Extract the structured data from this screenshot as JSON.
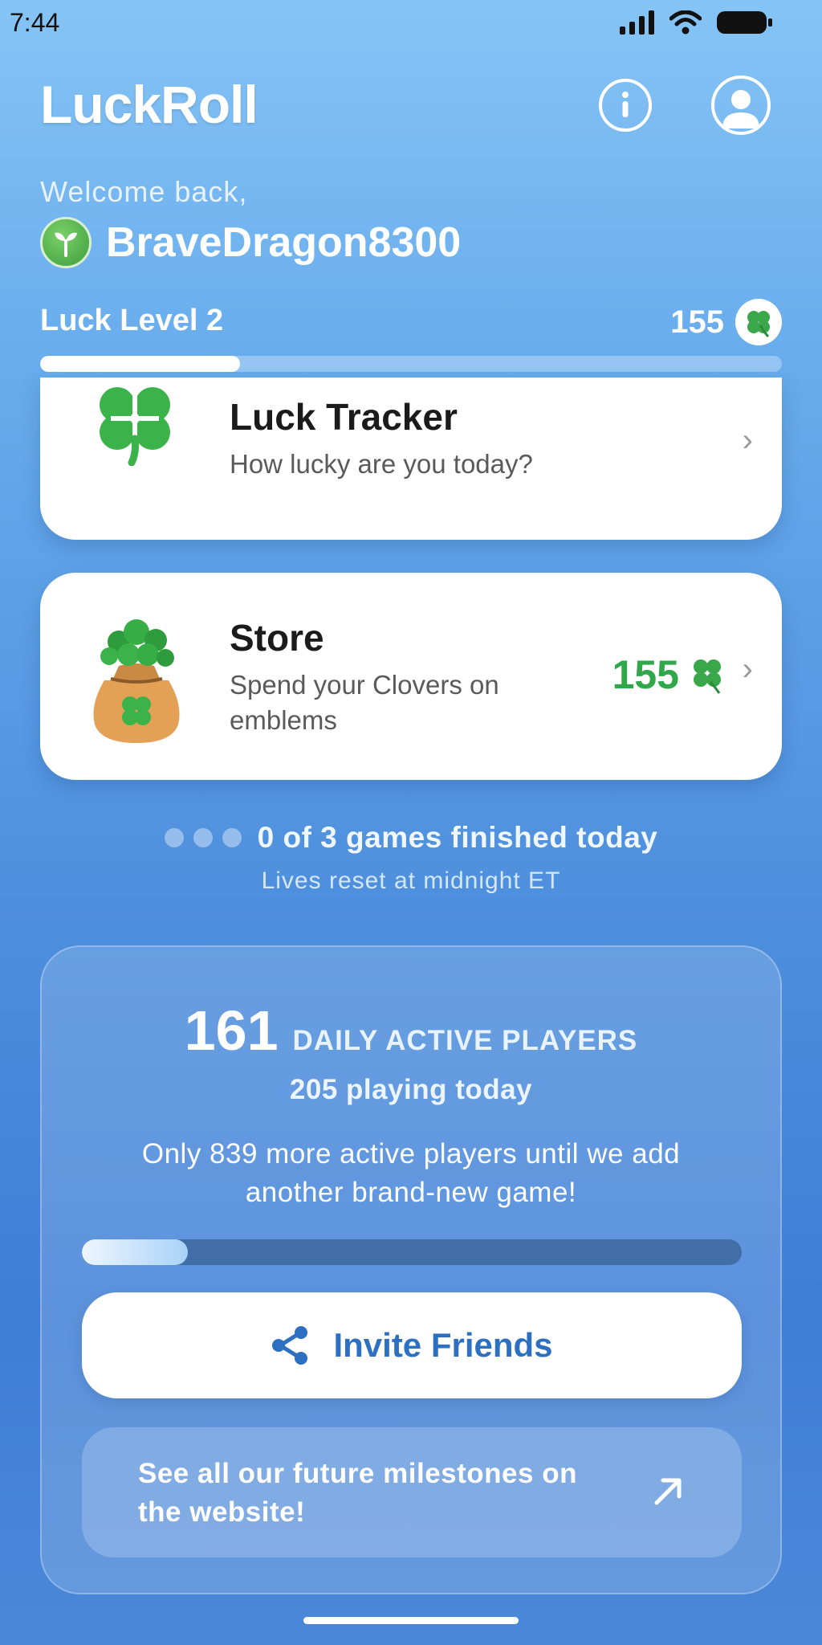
{
  "status_bar": {
    "time": "7:44"
  },
  "header": {
    "app_title": "LuckRoll"
  },
  "user": {
    "welcome": "Welcome back,",
    "username": "BraveDragon8300"
  },
  "level": {
    "label": "Luck Level 2",
    "clovers": "155",
    "progress": 0.27
  },
  "cards": {
    "tracker": {
      "title": "Luck Tracker",
      "subtitle": "How lucky are you today?"
    },
    "store": {
      "title": "Store",
      "subtitle": "Spend your Clovers on emblems",
      "price": "155"
    }
  },
  "lives": {
    "status": "0 of 3 games finished today",
    "reset": "Lives reset at midnight ET",
    "completed": 0,
    "total": 3
  },
  "stats": {
    "daily_active": "161",
    "daily_active_label": "DAILY ACTIVE PLAYERS",
    "playing_today": "205 playing today",
    "milestone_text": "Only 839 more active players until we add another brand-new game!",
    "milestone_progress": 0.16,
    "invite_label": "Invite Friends",
    "website_label": "See all our future milestones on the website!"
  },
  "colors": {
    "accent_green": "#2fa84a",
    "accent_blue": "#2d6fc1"
  }
}
